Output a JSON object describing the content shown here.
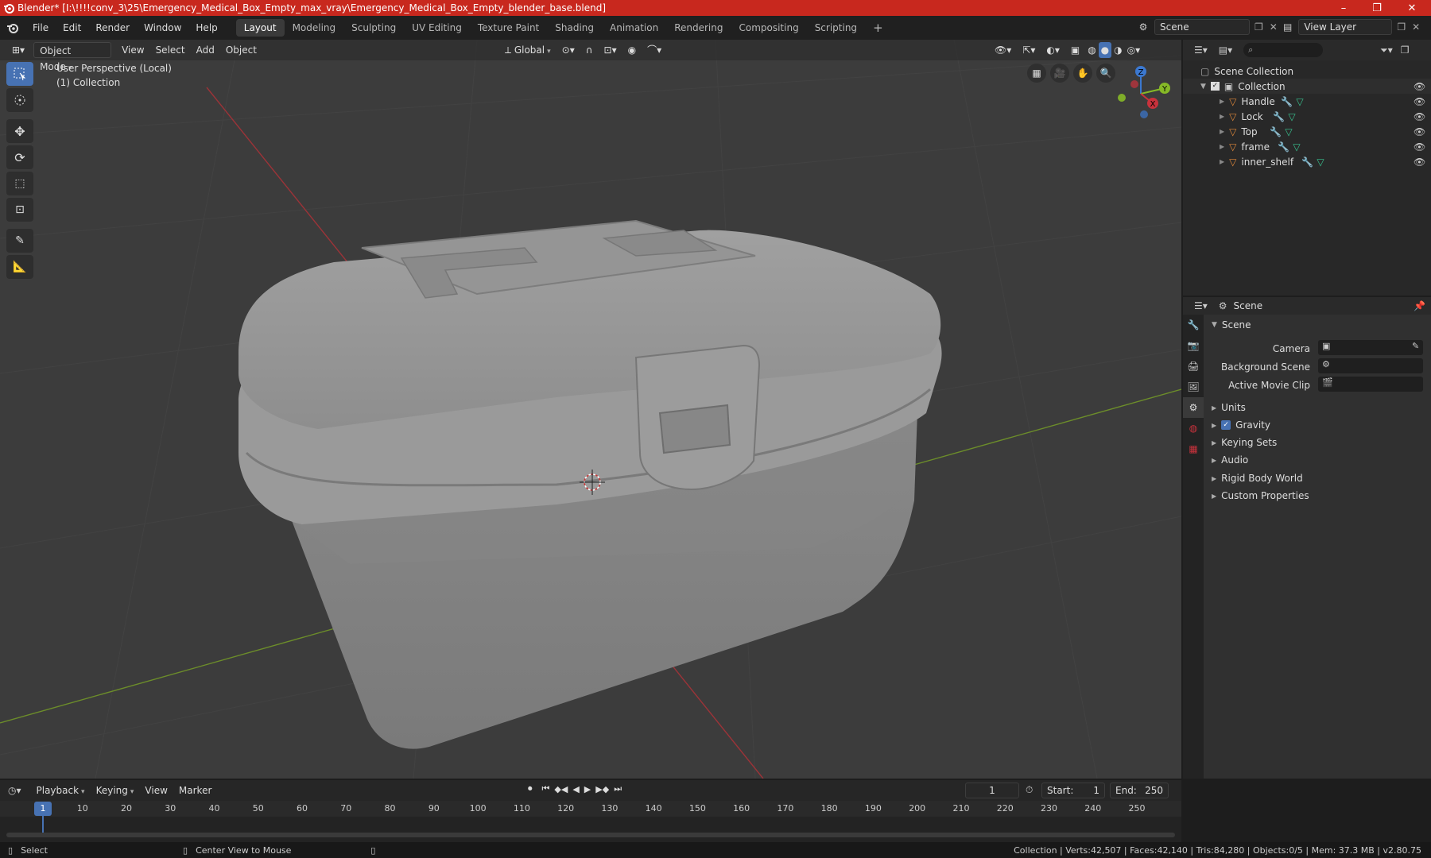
{
  "titlebar": {
    "title": "Blender* [I:\\!!!!conv_3\\25\\Emergency_Medical_Box_Empty_max_vray\\Emergency_Medical_Box_Empty_blender_base.blend]",
    "minimize": "–",
    "maximize": "❐",
    "close": "✕"
  },
  "menu": {
    "items": [
      "File",
      "Edit",
      "Render",
      "Window",
      "Help"
    ],
    "workspaces": [
      "Layout",
      "Modeling",
      "Sculpting",
      "UV Editing",
      "Texture Paint",
      "Shading",
      "Animation",
      "Rendering",
      "Compositing",
      "Scripting"
    ],
    "active_workspace": "Layout",
    "add_tab": "+",
    "scene_label": "Scene",
    "view_layer_label": "View Layer"
  },
  "viewport_header": {
    "mode": "Object Mode",
    "menus": [
      "View",
      "Select",
      "Add",
      "Object"
    ],
    "orientation": "Global"
  },
  "viewport": {
    "perspective": "User Perspective (Local)",
    "collection": "(1) Collection",
    "gizmo_axes": [
      "X",
      "Y",
      "Z"
    ]
  },
  "outliner": {
    "root": "Scene Collection",
    "collection": "Collection",
    "objects": [
      "Handle",
      "Lock",
      "Top",
      "frame",
      "inner_shelf"
    ],
    "search_placeholder": ""
  },
  "properties": {
    "header": "Scene",
    "panel_title": "Scene",
    "fields": [
      {
        "label": "Camera",
        "value": ""
      },
      {
        "label": "Background Scene",
        "value": ""
      },
      {
        "label": "Active Movie Clip",
        "value": ""
      }
    ],
    "sections": [
      "Units",
      "Gravity",
      "Keying Sets",
      "Audio",
      "Rigid Body World",
      "Custom Properties"
    ],
    "gravity_checked": true
  },
  "timeline": {
    "menus": [
      "Playback",
      "Keying",
      "View",
      "Marker"
    ],
    "current_frame": "1",
    "start_label": "Start:",
    "start": "1",
    "end_label": "End:",
    "end": "250",
    "ticks": [
      "1",
      "10",
      "20",
      "30",
      "40",
      "50",
      "60",
      "70",
      "80",
      "90",
      "100",
      "110",
      "120",
      "130",
      "140",
      "150",
      "160",
      "170",
      "180",
      "190",
      "200",
      "210",
      "220",
      "230",
      "240",
      "250"
    ]
  },
  "statusbar": {
    "select": "Select",
    "center_view": "Center View to Mouse",
    "stats": "Collection | Verts:42,507 | Faces:42,140 | Tris:84,280 | Objects:0/5 | Mem: 37.3 MB | v2.80.75"
  },
  "colors": {
    "titlebar": "#c8281e",
    "active_tool": "#4772b3",
    "x_axis": "#c9323c",
    "y_axis": "#86b927",
    "z_axis": "#3b78d0",
    "object_icon": "#e0883a",
    "modifier_icon": "#5f9be0",
    "mesh_icon": "#38c28f"
  }
}
